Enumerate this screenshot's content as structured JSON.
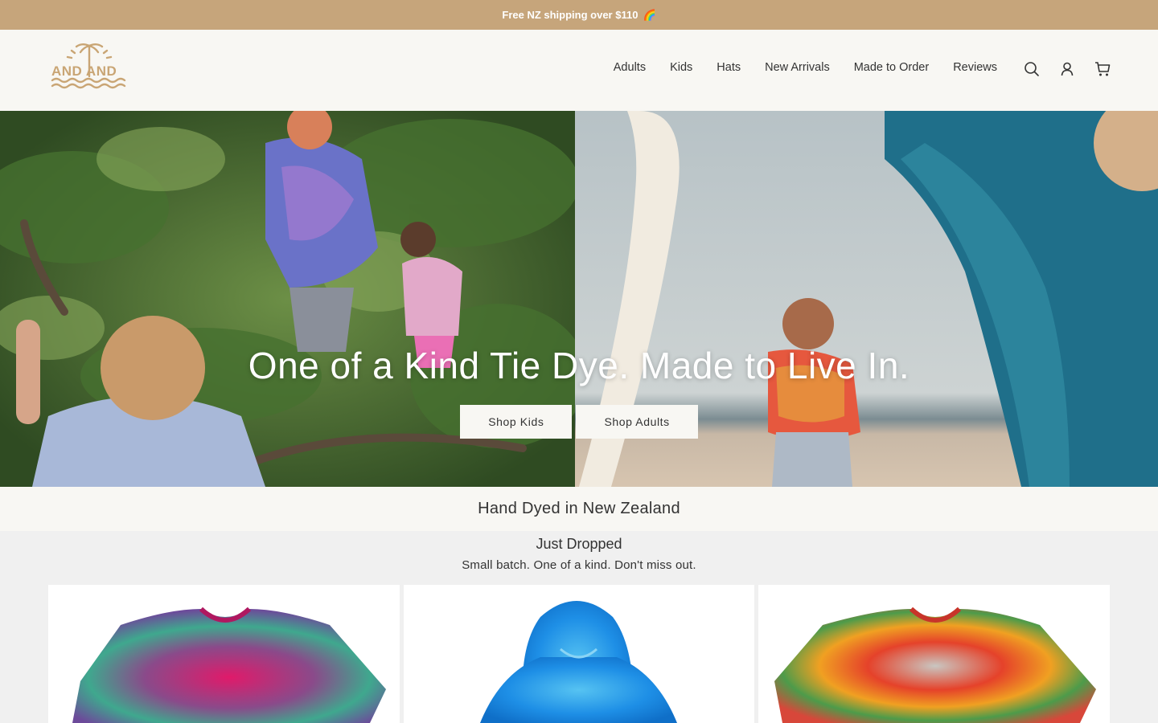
{
  "announcement": {
    "text": "Free NZ shipping over $110",
    "emoji": "🌈",
    "bg_color": "#c6a57b"
  },
  "brand": {
    "logo_text": "AND AND",
    "logo_color": "#c9a574"
  },
  "nav": {
    "items": [
      "Adults",
      "Kids",
      "Hats",
      "New Arrivals",
      "Made to Order",
      "Reviews"
    ]
  },
  "header_icons": [
    "search-icon",
    "account-icon",
    "cart-icon"
  ],
  "hero": {
    "title": "One of a Kind Tie Dye. Made to Live In.",
    "buttons": [
      "Shop Kids",
      "Shop Adults"
    ]
  },
  "strip": {
    "text": "Hand Dyed in New Zealand"
  },
  "collection": {
    "title": "Just Dropped",
    "subtitle": "Small batch. One of a kind. Don't miss out.",
    "products": [
      {
        "name": "tie-dye-tee-pink-purple",
        "colors": [
          "#e01a6a",
          "#6c4a9a",
          "#3fa88e"
        ]
      },
      {
        "name": "tie-dye-hoodie-blue",
        "colors": [
          "#1e8fe6",
          "#56c3f2",
          "#0f6fc8"
        ]
      },
      {
        "name": "tie-dye-tee-rainbow",
        "colors": [
          "#e5422a",
          "#f0a022",
          "#4d9b4a"
        ]
      }
    ]
  }
}
